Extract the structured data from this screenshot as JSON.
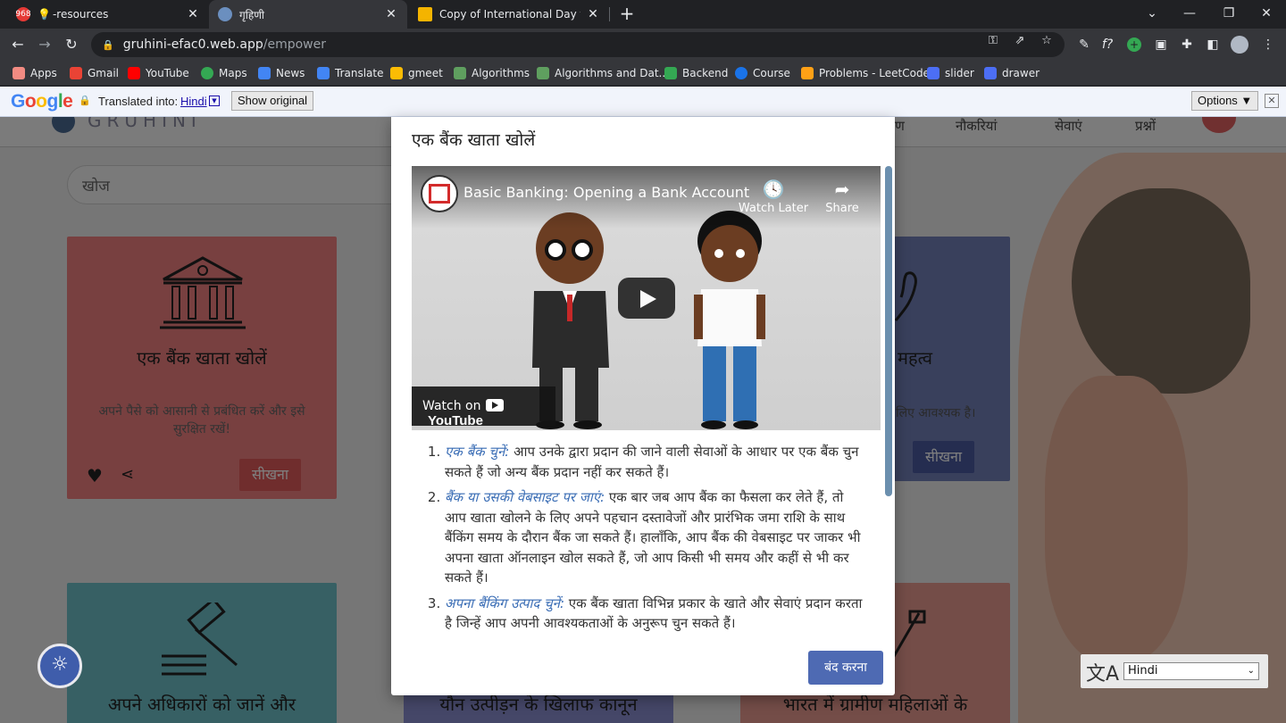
{
  "browser": {
    "tabs": [
      {
        "title": "-resources",
        "favicon_badge": "968"
      },
      {
        "title": "गृहिणी"
      },
      {
        "title": "Copy of International Day for the"
      }
    ],
    "address": {
      "host": "gruhini-efac0.web.app",
      "path": "/empower"
    },
    "bookmarks": [
      {
        "label": "Apps",
        "icon": "apps-grid-icon",
        "color": "#f28b82"
      },
      {
        "label": "Gmail",
        "icon": "gmail-icon",
        "color": "#ea4335"
      },
      {
        "label": "YouTube",
        "icon": "youtube-icon",
        "color": "#ff0000"
      },
      {
        "label": "Maps",
        "icon": "maps-icon",
        "color": "#34a853"
      },
      {
        "label": "News",
        "icon": "news-icon",
        "color": "#4285f4"
      },
      {
        "label": "Translate",
        "icon": "translate-icon",
        "color": "#4285f4"
      },
      {
        "label": "gmeet",
        "icon": "meet-icon",
        "color": "#fbbc04"
      },
      {
        "label": "Algorithms",
        "icon": "algorithms-icon",
        "color": "#5f9f5f"
      },
      {
        "label": "Algorithms and Dat...",
        "icon": "algorithms-icon",
        "color": "#5f9f5f"
      },
      {
        "label": "Backend",
        "icon": "backend-icon",
        "color": "#34a853"
      },
      {
        "label": "Course",
        "icon": "course-icon",
        "color": "#1a73e8"
      },
      {
        "label": "Problems - LeetCode",
        "icon": "leetcode-icon",
        "color": "#ffa116"
      },
      {
        "label": "slider",
        "icon": "slider-icon",
        "color": "#4c6ef5"
      },
      {
        "label": "drawer",
        "icon": "drawer-icon",
        "color": "#4c6ef5"
      }
    ]
  },
  "translate_bar": {
    "logo": "Google",
    "label": "Translated into:",
    "language": "Hindi",
    "show_original": "Show original",
    "options": "Options ▼"
  },
  "page": {
    "brand": "GRUHINI",
    "nav": [
      "ण",
      "नौकरियां",
      "सेवाएं",
      "प्रश्नों"
    ],
    "search_placeholder": "खोज",
    "cards": [
      {
        "title": "एक बैंक खाता खोलें",
        "desc": "अपने पैसे को आसानी से प्रबंधित करें और इसे सुरक्षित रखें!",
        "button": "सीखना",
        "color": "#f08080"
      },
      {
        "title": "महत्व",
        "desc": "लिए आवश्यक है।",
        "button": "सीखना",
        "color": "#7380b8"
      },
      {
        "title": "अपने अधिकारों को जानें और",
        "color": "#6fc0c9"
      },
      {
        "title": "यौन उत्पीड़न के खिलाफ कानून",
        "color": "#8a8fd0"
      },
      {
        "title": "भारत में ग्रामीण महिलाओं के",
        "color": "#e99a90"
      }
    ],
    "lang_select": "Hindi"
  },
  "modal": {
    "title": "एक बैंक खाता खोलें",
    "video": {
      "title": "Basic Banking: Opening a Bank Account",
      "watch_later": "Watch Later",
      "share": "Share",
      "watch_on": "Watch on",
      "youtube": "YouTube"
    },
    "steps": [
      {
        "lead": "एक बैंक चुनें:",
        "text": " आप उनके द्वारा प्रदान की जाने वाली सेवाओं के आधार पर एक बैंक चुन सकते हैं जो अन्य बैंक प्रदान नहीं कर सकते हैं।"
      },
      {
        "lead": "बैंक या उसकी वेबसाइट पर जाएं:",
        "text": " एक बार जब आप बैंक का फैसला कर लेते हैं, तो आप खाता खोलने के लिए अपने पहचान दस्तावेजों और प्रारंभिक जमा राशि के साथ बैंकिंग समय के दौरान बैंक जा सकते हैं। हालाँकि, आप बैंक की वेबसाइट पर जाकर भी अपना खाता ऑनलाइन खोल सकते हैं, जो आप किसी भी समय और कहीं से भी कर सकते हैं।"
      },
      {
        "lead": "अपना बैंकिंग उत्पाद चुनें:",
        "text": " एक बैंक खाता विभिन्न प्रकार के खाते और सेवाएं प्रदान करता है जिन्हें आप अपनी आवश्यकताओं के अनुरूप चुन सकते हैं।"
      }
    ],
    "close": "बंद करना"
  }
}
